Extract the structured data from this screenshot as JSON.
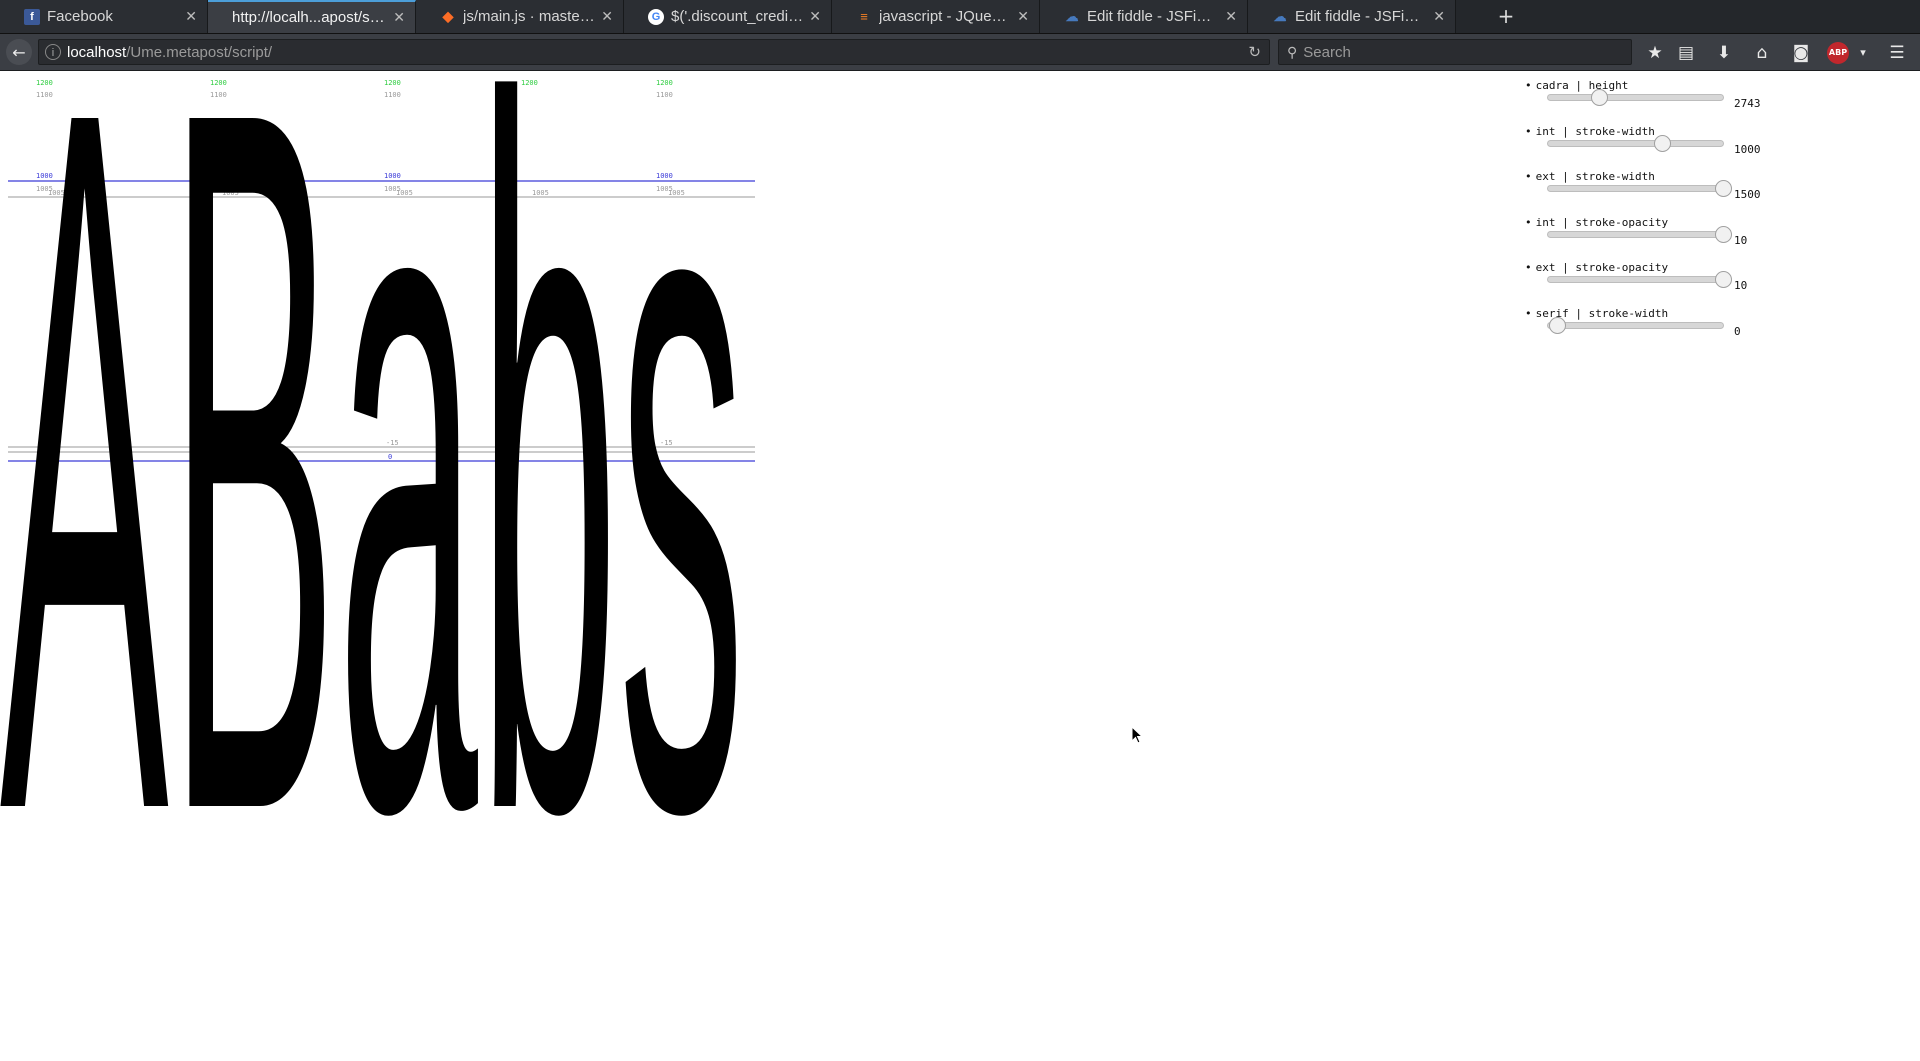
{
  "browser": {
    "tabs": [
      {
        "title": "Facebook",
        "icon": "facebook-icon",
        "active": false
      },
      {
        "title": "http://localh...apost/script/",
        "icon": "none",
        "active": true
      },
      {
        "title": "js/main.js · master · at...",
        "icon": "gitlab-icon",
        "active": false
      },
      {
        "title": "$('.discount_credits')....",
        "icon": "google-icon",
        "active": false
      },
      {
        "title": "javascript - JQuery Ra...",
        "icon": "stackoverflow-icon",
        "active": false
      },
      {
        "title": "Edit fiddle - JSFiddle",
        "icon": "jsfiddle-icon",
        "active": false
      },
      {
        "title": "Edit fiddle - JSFiddle",
        "icon": "jsfiddle-icon",
        "active": false
      }
    ],
    "url_host": "localhost",
    "url_path": "/Ume.metapost/script/",
    "search_placeholder": "Search"
  },
  "glyphs": {
    "text": "ABabs",
    "guide_labels": {
      "top": "1200",
      "top_sub": "1100",
      "cap": "1000",
      "cap_sub": "1005",
      "base": "0",
      "base_sub": "-15"
    }
  },
  "controls": [
    {
      "label": "cadra | height",
      "value": "2743",
      "fraction": 0.29
    },
    {
      "label": "int | stroke-width",
      "value": "1000",
      "fraction": 0.65
    },
    {
      "label": "ext | stroke-width",
      "value": "1500",
      "fraction": 1.0
    },
    {
      "label": "int | stroke-opacity",
      "value": "10",
      "fraction": 1.0
    },
    {
      "label": "ext | stroke-opacity",
      "value": "10",
      "fraction": 1.0
    },
    {
      "label": "serif | stroke-width",
      "value": "0",
      "fraction": 0.05
    }
  ]
}
